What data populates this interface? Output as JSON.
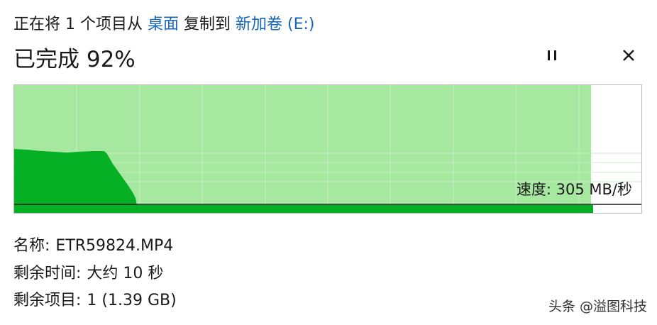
{
  "header": {
    "prefix": "正在将 1 个项目从",
    "source": "桌面",
    "middle": "复制到",
    "destination": "新加卷 (E:)"
  },
  "title": "已完成 92%",
  "progress": {
    "percent": 92
  },
  "graph": {
    "speed_label": "速度:",
    "speed_value": "305 MB/秒"
  },
  "details": {
    "name_label": "名称:",
    "name_value": "ETR59824.MP4",
    "time_label": "剩余时间:",
    "time_value": "大约 10 秒",
    "items_label": "剩余项目:",
    "items_value": "1 (1.39 GB)"
  },
  "controls": {
    "pause_icon": "pause-icon",
    "close_icon": "close-icon"
  },
  "colors": {
    "link": "#1565b8",
    "progress_fill": "#a6e8a0",
    "speed_fill": "#06b025",
    "grid": "#c9ecc6",
    "border": "#bcbcbc"
  },
  "watermark": "头条 @溢图科技"
}
